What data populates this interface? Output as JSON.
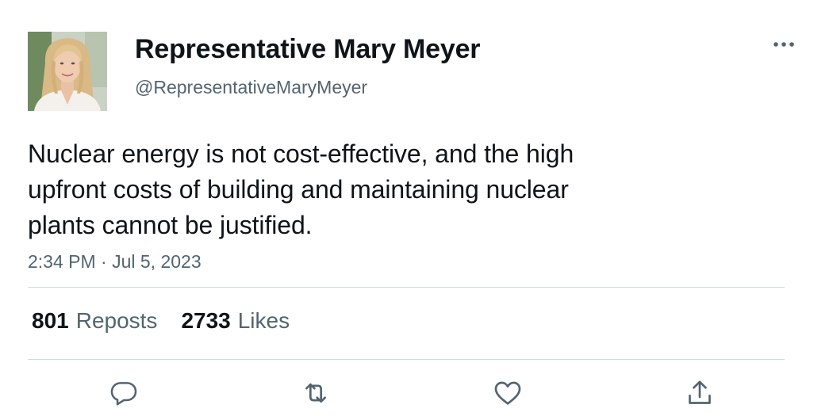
{
  "author": {
    "display_name": "Representative Mary Meyer",
    "handle": "@RepresentativeMaryMeyer"
  },
  "tweet": {
    "text_lines": [
      "Nuclear energy is not cost-effective, and the high",
      "upfront costs of building and maintaining nuclear",
      "plants cannot be justified."
    ],
    "timestamp": "2:34 PM · Jul 5, 2023"
  },
  "stats": {
    "reposts_count": "801",
    "reposts_label": "Reposts",
    "likes_count": "2733",
    "likes_label": "Likes"
  },
  "icons": {
    "more": "more-dots-icon",
    "reply": "reply-icon",
    "repost": "repost-icon",
    "like": "heart-icon",
    "share": "share-icon"
  },
  "colors": {
    "text_primary": "#0f1419",
    "text_secondary": "#536471",
    "divider": "#cfd9de"
  }
}
